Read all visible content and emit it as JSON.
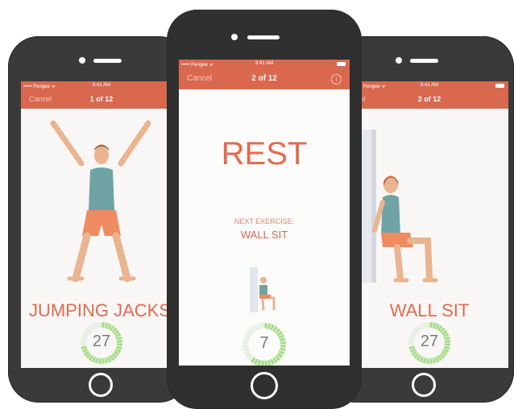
{
  "left_phone": {
    "status": {
      "carrier": "••••• Perigee ᯤ",
      "time": "9:41 AM"
    },
    "nav": {
      "cancel": "Cancel",
      "title": "1 of 12"
    },
    "exercise_name": "JUMPING JACKS",
    "timer_value": "27",
    "timer_progress": 0.72
  },
  "center_phone": {
    "status": {
      "carrier": "••••• Perigee ᯤ",
      "time": "9:41 AM"
    },
    "nav": {
      "cancel": "Cancel",
      "title": "2 of 12",
      "info_icon": "info-icon"
    },
    "headline": "REST",
    "next_label": "NEXT EXERCISE:",
    "next_exercise": "WALL SIT",
    "timer_value": "7",
    "timer_progress": 0.62
  },
  "right_phone": {
    "status": {
      "carrier": "Perigee ᯤ",
      "time": "9:41 AM"
    },
    "nav": {
      "cancel": "ncel",
      "title": "2 of 12"
    },
    "exercise_name": "WALL SIT",
    "timer_value": "27",
    "timer_progress": 0.72
  },
  "colors": {
    "accent": "#d9684f",
    "title_text": "#e36a50",
    "timer_green": "#a8dd8a",
    "phone_body": "#3a3a3a"
  }
}
